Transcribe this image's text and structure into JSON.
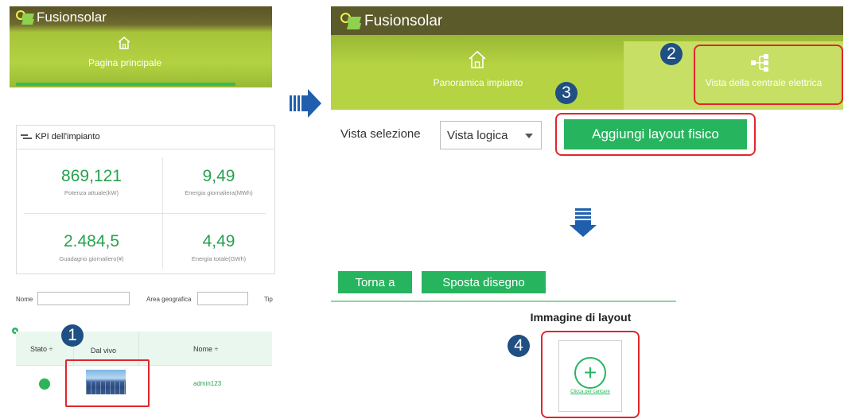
{
  "left_panel": {
    "app_title": "Fusionsolar",
    "home_label": "Pagina principale",
    "kpi": {
      "title": "KPI dell'impianto",
      "items": [
        {
          "value": "869,121",
          "label": "Potenza attuale(kW)"
        },
        {
          "value": "9,49",
          "label": "Energia giornaliera(MWh)"
        },
        {
          "value": "2.484,5",
          "label": "Guadagno giornaliero(¥)"
        },
        {
          "value": "4,49",
          "label": "Energia totale(GWh)"
        }
      ]
    },
    "filters": {
      "name_label": "Nome",
      "area_label": "Area geografica",
      "type_label": "Tip"
    },
    "table": {
      "columns": [
        "Stato ÷",
        "Dal vivo",
        "Nome ÷"
      ],
      "row": {
        "name": "admin123"
      }
    },
    "badge_1": "1"
  },
  "right_panel": {
    "app_title": "Fusionsolar",
    "nav_overview": "Panoramica impianto",
    "nav_plant_view": "Vista della centrale elettrica",
    "badge_2": "2",
    "badge_3": "3",
    "view_selection_label": "Vista selezione",
    "view_select_value": "Vista logica",
    "add_layout_button": "Aggiungi layout fisico",
    "back_button": "Torna a",
    "move_drawing_button": "Sposta disegno",
    "layout_image_title": "Immagine di layout",
    "badge_4": "4",
    "upload_label": "Clicca per caricare"
  },
  "colors": {
    "accent_green": "#27b45f",
    "header_olive": "#5b5a2a",
    "banner_lime": "#b1cf3f",
    "highlight_red": "#e0262c",
    "badge_blue": "#1f4f83"
  }
}
